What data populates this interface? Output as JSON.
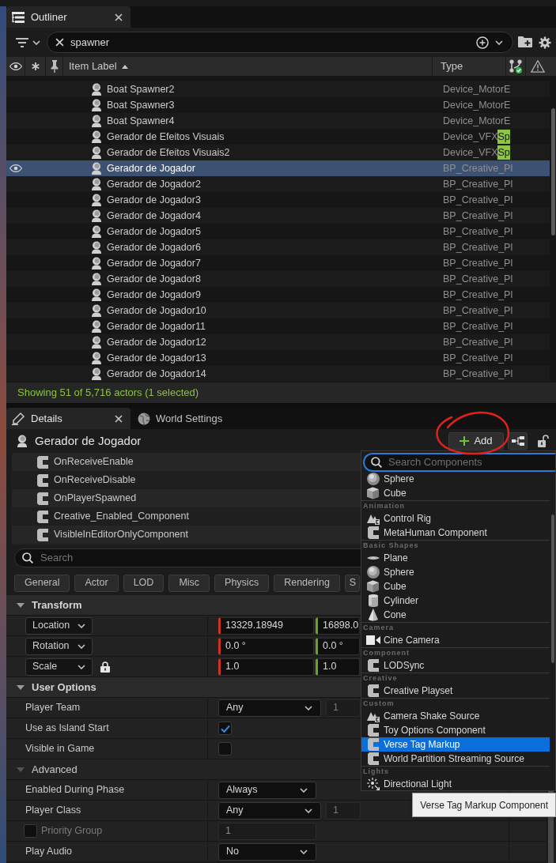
{
  "outliner": {
    "tab": {
      "label": "Outliner"
    },
    "search": {
      "value": "spawner"
    },
    "columns": [
      {
        "label": "Item Label",
        "sorted": true
      },
      {
        "label": "Type",
        "sorted": false
      }
    ],
    "rows": [
      {
        "label": "Boat Spawner2",
        "type": "Device_MotorE",
        "selected": false
      },
      {
        "label": "Boat Spawner3",
        "type": "Device_MotorE",
        "selected": false
      },
      {
        "label": "Boat Spawner4",
        "type": "Device_MotorE",
        "selected": false
      },
      {
        "label": "Gerador de Efeitos Visuais",
        "type": "Device_VFX",
        "type_match": "Sp",
        "selected": false
      },
      {
        "label": "Gerador de Efeitos Visuais2",
        "type": "Device_VFX",
        "type_match": "Sp",
        "selected": false
      },
      {
        "label": "Gerador de Jogador",
        "type": "BP_Creative_Pl",
        "selected": true
      },
      {
        "label": "Gerador de Jogador2",
        "type": "BP_Creative_Pl",
        "selected": false
      },
      {
        "label": "Gerador de Jogador3",
        "type": "BP_Creative_Pl",
        "selected": false
      },
      {
        "label": "Gerador de Jogador4",
        "type": "BP_Creative_Pl",
        "selected": false
      },
      {
        "label": "Gerador de Jogador5",
        "type": "BP_Creative_Pl",
        "selected": false
      },
      {
        "label": "Gerador de Jogador6",
        "type": "BP_Creative_Pl",
        "selected": false
      },
      {
        "label": "Gerador de Jogador7",
        "type": "BP_Creative_Pl",
        "selected": false
      },
      {
        "label": "Gerador de Jogador8",
        "type": "BP_Creative_Pl",
        "selected": false
      },
      {
        "label": "Gerador de Jogador9",
        "type": "BP_Creative_Pl",
        "selected": false
      },
      {
        "label": "Gerador de Jogador10",
        "type": "BP_Creative_Pl",
        "selected": false
      },
      {
        "label": "Gerador de Jogador11",
        "type": "BP_Creative_Pl",
        "selected": false
      },
      {
        "label": "Gerador de Jogador12",
        "type": "BP_Creative_Pl",
        "selected": false
      },
      {
        "label": "Gerador de Jogador13",
        "type": "BP_Creative_Pl",
        "selected": false
      },
      {
        "label": "Gerador de Jogador14",
        "type": "BP_Creative_Pl",
        "selected": false
      }
    ],
    "status": "Showing 51 of 5,716 actors (1 selected)"
  },
  "details": {
    "tabs": [
      {
        "label": "Details",
        "kind": "details",
        "selected": true
      },
      {
        "label": "World Settings",
        "kind": "world",
        "selected": false
      }
    ],
    "actor": "Gerador de Jogador",
    "add_button": "Add",
    "components": [
      "OnReceiveEnable",
      "OnReceiveDisable",
      "OnPlayerSpawned",
      "Creative_Enabled_Component",
      "VisibleInEditorOnlyComponent"
    ],
    "search": {
      "placeholder": "Search"
    },
    "filters": [
      "General",
      "Actor",
      "LOD",
      "Misc",
      "Physics",
      "Rendering",
      "S"
    ],
    "sections": [
      {
        "title": "Transform",
        "kind": "category",
        "expanded": true,
        "rows": [
          {
            "kind": "vector",
            "label": "Location",
            "values": [
              "13329.18949",
              "16898.0"
            ]
          },
          {
            "kind": "vector",
            "label": "Rotation",
            "values": [
              "0.0 °",
              "0.0 °"
            ]
          },
          {
            "kind": "vector",
            "label": "Scale",
            "values": [
              "1.0",
              "1.0"
            ],
            "locked": true
          }
        ]
      },
      {
        "title": "User Options",
        "kind": "category",
        "expanded": true,
        "rows": [
          {
            "kind": "dropdown",
            "label": "Player Team",
            "value": "Any",
            "extra": "1"
          },
          {
            "kind": "checkbox",
            "label": "Use as Island Start",
            "checked": true
          },
          {
            "kind": "checkbox",
            "label": "Visible in Game",
            "checked": false
          }
        ]
      },
      {
        "title": "Advanced",
        "kind": "subcategory",
        "expanded": true,
        "rows": [
          {
            "kind": "dropdown",
            "label": "Enabled During Phase",
            "value": "Always"
          },
          {
            "kind": "dropdown",
            "label": "Player Class",
            "value": "Any",
            "extra": "1"
          },
          {
            "kind": "number",
            "label": "Priority Group",
            "value": "1",
            "enabled": false
          },
          {
            "kind": "dropdown",
            "label": "Play Audio",
            "value": "No"
          }
        ]
      }
    ]
  },
  "add_menu": {
    "search": {
      "placeholder": "Search Components"
    },
    "groups": [
      {
        "items": [
          {
            "label": "Sphere",
            "kind": "sphere",
            "selected": false
          },
          {
            "label": "Cube",
            "kind": "cube",
            "selected": false
          }
        ]
      },
      {
        "header": "Animation",
        "items": [
          {
            "label": "Control Rig",
            "kind": "rig",
            "selected": false
          },
          {
            "label": "MetaHuman Component",
            "kind": "component",
            "selected": false
          }
        ]
      },
      {
        "header": "Basic Shapes",
        "items": [
          {
            "label": "Plane",
            "kind": "plane",
            "selected": false
          },
          {
            "label": "Sphere",
            "kind": "sphere",
            "selected": false
          },
          {
            "label": "Cube",
            "kind": "cube",
            "selected": false
          },
          {
            "label": "Cylinder",
            "kind": "cylinder",
            "selected": false
          },
          {
            "label": "Cone",
            "kind": "cone",
            "selected": false
          }
        ]
      },
      {
        "header": "Camera",
        "items": [
          {
            "label": "Cine Camera",
            "kind": "camera",
            "selected": false
          }
        ]
      },
      {
        "header": "Component",
        "items": [
          {
            "label": "LODSync",
            "kind": "component",
            "selected": false
          }
        ]
      },
      {
        "header": "Creative",
        "items": [
          {
            "label": "Creative Playset",
            "kind": "component",
            "selected": false
          }
        ]
      },
      {
        "header": "Custom",
        "items": [
          {
            "label": "Camera Shake Source",
            "kind": "rig",
            "selected": false
          },
          {
            "label": "Toy Options Component",
            "kind": "component",
            "selected": false
          },
          {
            "label": "Verse Tag Markup",
            "kind": "component",
            "selected": true
          },
          {
            "label": "World Partition Streaming Source",
            "kind": "component",
            "selected": false
          }
        ]
      },
      {
        "header": "Lights",
        "items": [
          {
            "label": "Directional Light",
            "kind": "light",
            "selected": false
          }
        ]
      }
    ]
  },
  "tooltip": "Verse Tag Markup Component"
}
